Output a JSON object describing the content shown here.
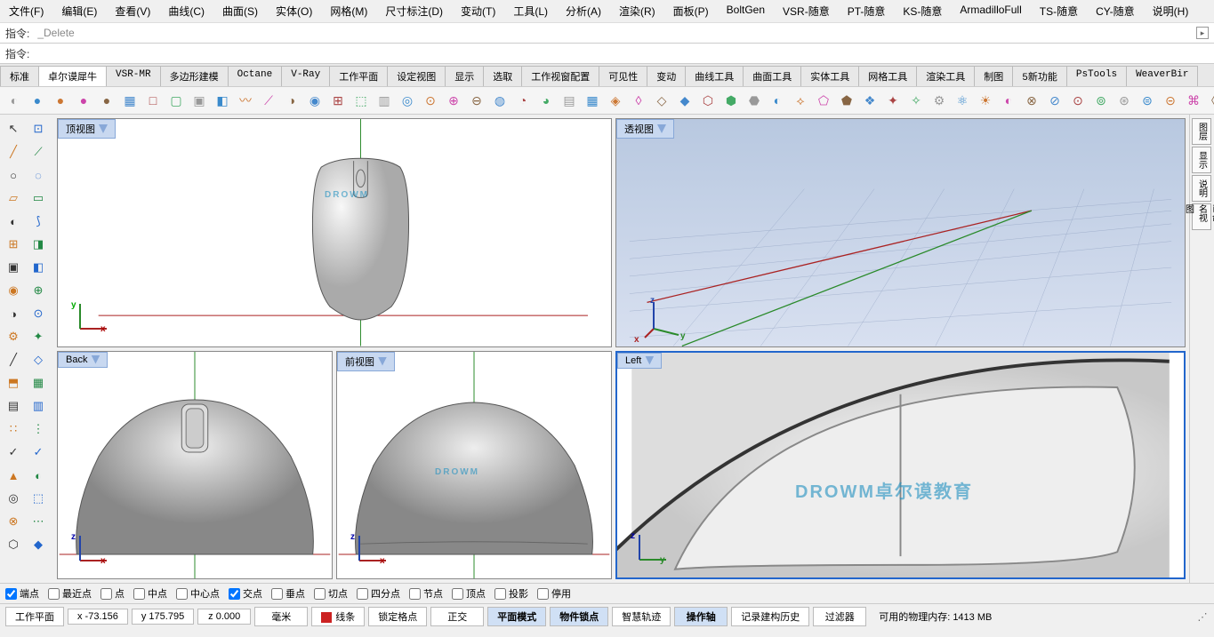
{
  "menu": [
    "文件(F)",
    "编辑(E)",
    "查看(V)",
    "曲线(C)",
    "曲面(S)",
    "实体(O)",
    "网格(M)",
    "尺寸标注(D)",
    "变动(T)",
    "工具(L)",
    "分析(A)",
    "渲染(R)",
    "面板(P)",
    "BoltGen",
    "VSR-随意",
    "PT-随意",
    "KS-随意",
    "ArmadilloFull",
    "TS-随意",
    "CY-随意",
    "说明(H)"
  ],
  "cmd": {
    "label1": "指令:",
    "history": "_Delete",
    "label2": "指令:"
  },
  "tabs": [
    "标准",
    "卓尔谟犀牛",
    "VSR-MR",
    "多边形建模",
    "Octane",
    "V-Ray",
    "工作平面",
    "设定视图",
    "显示",
    "选取",
    "工作视窗配置",
    "可见性",
    "变动",
    "曲线工具",
    "曲面工具",
    "实体工具",
    "网格工具",
    "渲染工具",
    "制图",
    "5新功能",
    "PsTools",
    "WeaverBir"
  ],
  "tabs_active": 1,
  "viewports": {
    "top": {
      "title": "顶视图",
      "axes": [
        "x",
        "y"
      ]
    },
    "persp": {
      "title": "透视图",
      "axes": [
        "x",
        "y",
        "z"
      ]
    },
    "back": {
      "title": "Back",
      "axes": [
        "x",
        "z"
      ]
    },
    "front": {
      "title": "前视图",
      "axes": [
        "x",
        "z"
      ]
    },
    "left": {
      "title": "Left",
      "axes": [
        "y",
        "z"
      ]
    }
  },
  "watermark": "DROWM卓尔谟教育",
  "watermark2": "DROWM",
  "osnap": [
    {
      "label": "端点",
      "checked": true
    },
    {
      "label": "最近点",
      "checked": false
    },
    {
      "label": "点",
      "checked": false
    },
    {
      "label": "中点",
      "checked": false
    },
    {
      "label": "中心点",
      "checked": false
    },
    {
      "label": "交点",
      "checked": true
    },
    {
      "label": "垂点",
      "checked": false
    },
    {
      "label": "切点",
      "checked": false
    },
    {
      "label": "四分点",
      "checked": false
    },
    {
      "label": "节点",
      "checked": false
    },
    {
      "label": "顶点",
      "checked": false
    },
    {
      "label": "投影",
      "checked": false
    },
    {
      "label": "停用",
      "checked": false
    }
  ],
  "status": {
    "cplane": "工作平面",
    "x": "x -73.156",
    "y": "y 175.795",
    "z": "z 0.000",
    "unit": "毫米",
    "layer": "线条",
    "toggles": [
      {
        "label": "锁定格点",
        "on": false
      },
      {
        "label": "正交",
        "on": false
      },
      {
        "label": "平面模式",
        "on": true
      },
      {
        "label": "物件锁点",
        "on": true
      },
      {
        "label": "智慧轨迹",
        "on": false
      },
      {
        "label": "操作轴",
        "on": true
      },
      {
        "label": "记录建构历史",
        "on": false
      },
      {
        "label": "过滤器",
        "on": false
      }
    ],
    "mem": "可用的物理内存: 1413 MB"
  },
  "right_tabs": [
    "图层",
    "显示",
    "说明",
    "已命名视图"
  ]
}
